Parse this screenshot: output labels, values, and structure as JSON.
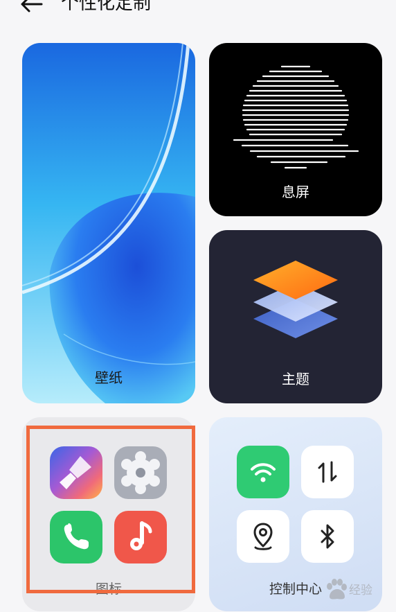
{
  "header": {
    "title": "个性化定制"
  },
  "cards": {
    "wallpaper": {
      "label": "壁纸"
    },
    "aod": {
      "label": "息屏"
    },
    "theme": {
      "label": "主题"
    },
    "icons": {
      "label": "图标"
    },
    "control_center": {
      "label": "控制中心"
    }
  },
  "icon_tiles": [
    "paint-brush-app-icon",
    "settings-app-icon",
    "phone-app-icon",
    "music-app-icon"
  ],
  "control_tiles": [
    "wifi-toggle",
    "mobile-data-toggle",
    "location-toggle",
    "bluetooth-toggle"
  ],
  "colors": {
    "wifi_active": "#2fcb73",
    "phone_green": "#2cc56a",
    "music_red": "#f0574a",
    "highlight": "#f06a3e"
  },
  "watermark": {
    "text": "经验"
  }
}
